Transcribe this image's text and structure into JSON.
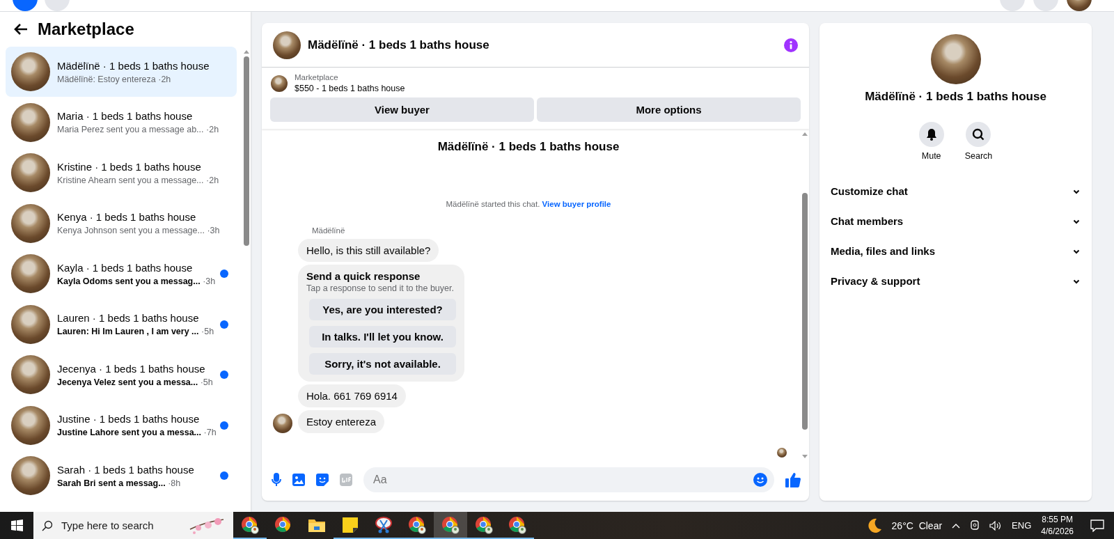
{
  "sidebar": {
    "title": "Marketplace",
    "conversations": [
      {
        "title": "Mädëlïnë · 1 beds 1 baths house",
        "preview": "Mädëlïnë: Estoy entereza",
        "time": "·2h",
        "selected": true,
        "unread": false
      },
      {
        "title": "Maria · 1 beds 1 baths house",
        "preview": "Maria Perez sent you a message ab...",
        "time": "·2h",
        "selected": false,
        "unread": false
      },
      {
        "title": "Kristine · 1 beds 1 baths house",
        "preview": "Kristine Ahearn sent you a message...",
        "time": "·2h",
        "selected": false,
        "unread": false
      },
      {
        "title": "Kenya · 1 beds 1 baths house",
        "preview": "Kenya Johnson sent you a message...",
        "time": "·3h",
        "selected": false,
        "unread": false
      },
      {
        "title": "Kayla · 1 beds 1 baths house",
        "preview": "Kayla Odoms sent you a messag...",
        "time": "·3h",
        "selected": false,
        "unread": true
      },
      {
        "title": "Lauren · 1 beds 1 baths house",
        "preview": "Lauren: Hi Im Lauren , I am very ...",
        "time": "·5h",
        "selected": false,
        "unread": true
      },
      {
        "title": "Jecenya · 1 beds 1 baths house",
        "preview": "Jecenya Velez sent you a messa...",
        "time": "·5h",
        "selected": false,
        "unread": true
      },
      {
        "title": "Justine · 1 beds 1 baths house",
        "preview": "Justine Lahore sent you a messa...",
        "time": "·7h",
        "selected": false,
        "unread": true
      },
      {
        "title": "Sarah · 1 beds 1 baths house",
        "preview": "Sarah Bri sent a messag...",
        "time": "·8h",
        "selected": false,
        "unread": true
      }
    ]
  },
  "chat": {
    "title": "Mädëlïnë · 1 beds 1 baths house",
    "listing": {
      "source": "Marketplace",
      "summary": "$550 - 1 beds 1 baths house"
    },
    "buttons": [
      "View buyer",
      "More options"
    ],
    "thread_title": "Mädëlïnë · 1 beds 1 baths house",
    "notice": {
      "text": "Mädëlïnë started this chat.",
      "link": "View buyer profile"
    },
    "sender": "Mädëlïnë",
    "messages": [
      {
        "kind": "text",
        "text": "Hello, is this still available?",
        "avatar": false
      },
      {
        "kind": "quick_responses",
        "title": "Send a quick response",
        "subtitle": "Tap a response to send it to the buyer.",
        "options": [
          "Yes, are you interested?",
          "In talks. I'll let you know.",
          "Sorry, it's not available."
        ]
      },
      {
        "kind": "text",
        "text": "Hola. 661 769 6914",
        "avatar": false
      },
      {
        "kind": "text",
        "text": "Estoy entereza",
        "avatar": true
      }
    ],
    "composer": {
      "placeholder": "Aa"
    }
  },
  "details": {
    "name": "Mädëlïnë · 1 beds 1 baths house",
    "actions": [
      {
        "label": "Mute",
        "kind": "bell"
      },
      {
        "label": "Search",
        "kind": "search"
      }
    ],
    "sections": [
      {
        "label": "Customize chat",
        "expanded": false
      },
      {
        "label": "Chat members",
        "expanded": false
      },
      {
        "label": "Media, files and links",
        "expanded": false
      },
      {
        "label": "Privacy & support",
        "expanded": false
      }
    ]
  },
  "taskbar": {
    "search_placeholder": "Type here to search",
    "apps": [
      {
        "kind": "chrome-badge",
        "running": true,
        "selected": false
      },
      {
        "kind": "chrome",
        "running": false,
        "selected": false
      },
      {
        "kind": "folder",
        "running": false,
        "selected": false
      },
      {
        "kind": "note",
        "running": true,
        "selected": false
      },
      {
        "kind": "snip",
        "running": true,
        "selected": false
      },
      {
        "kind": "chrome-badge",
        "running": true,
        "selected": false
      },
      {
        "kind": "chrome-profile",
        "running": true,
        "selected": true
      },
      {
        "kind": "chrome-profile",
        "running": true,
        "selected": false
      },
      {
        "kind": "chrome-profile",
        "running": true,
        "selected": false
      }
    ],
    "weather": {
      "temperature": "26°C",
      "condition": "Clear"
    },
    "language": "ENG",
    "time": "8:55 PM",
    "date": "4/6/2026"
  }
}
